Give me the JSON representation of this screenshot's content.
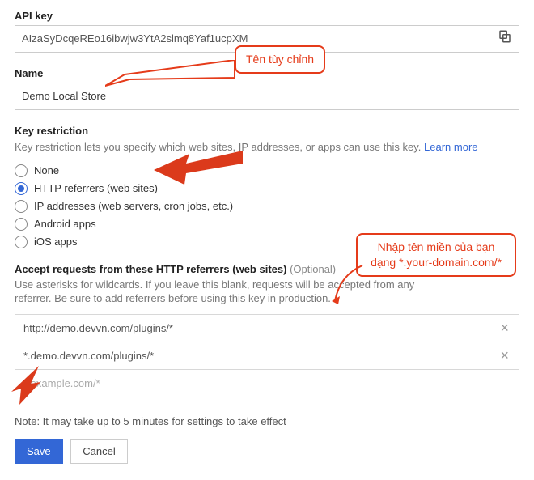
{
  "api": {
    "label": "API key",
    "value": "AIzaSyDcqeREo16ibwjw3YtA2slmq8Yaf1ucpXM"
  },
  "name": {
    "label": "Name",
    "value": "Demo Local Store"
  },
  "restriction": {
    "title": "Key restriction",
    "desc": "Key restriction lets you specify which web sites, IP addresses, or apps can use this key. ",
    "learn_more": "Learn more",
    "options": {
      "none": "None",
      "http": "HTTP referrers (web sites)",
      "ip": "IP addresses (web servers, cron jobs, etc.)",
      "android": "Android apps",
      "ios": "iOS apps"
    },
    "selected": "http"
  },
  "referrers": {
    "title": "Accept requests from these HTTP referrers (web sites)",
    "optional": "(Optional)",
    "desc": "Use asterisks for wildcards. If you leave this blank, requests will be accepted from any referrer. Be sure to add referrers before using this key in production.",
    "items": [
      "http://demo.devvn.com/plugins/*",
      "*.demo.devvn.com/plugins/*"
    ],
    "placeholder": "*.example.com/*"
  },
  "note": "Note: It may take up to 5 minutes for settings to take effect",
  "buttons": {
    "save": "Save",
    "cancel": "Cancel"
  },
  "annotations": {
    "custom_name": "Tên tùy chỉnh",
    "domain_hint_l1": "Nhập tên miền của bạn",
    "domain_hint_l2": "dạng *.your-domain.com/*"
  }
}
